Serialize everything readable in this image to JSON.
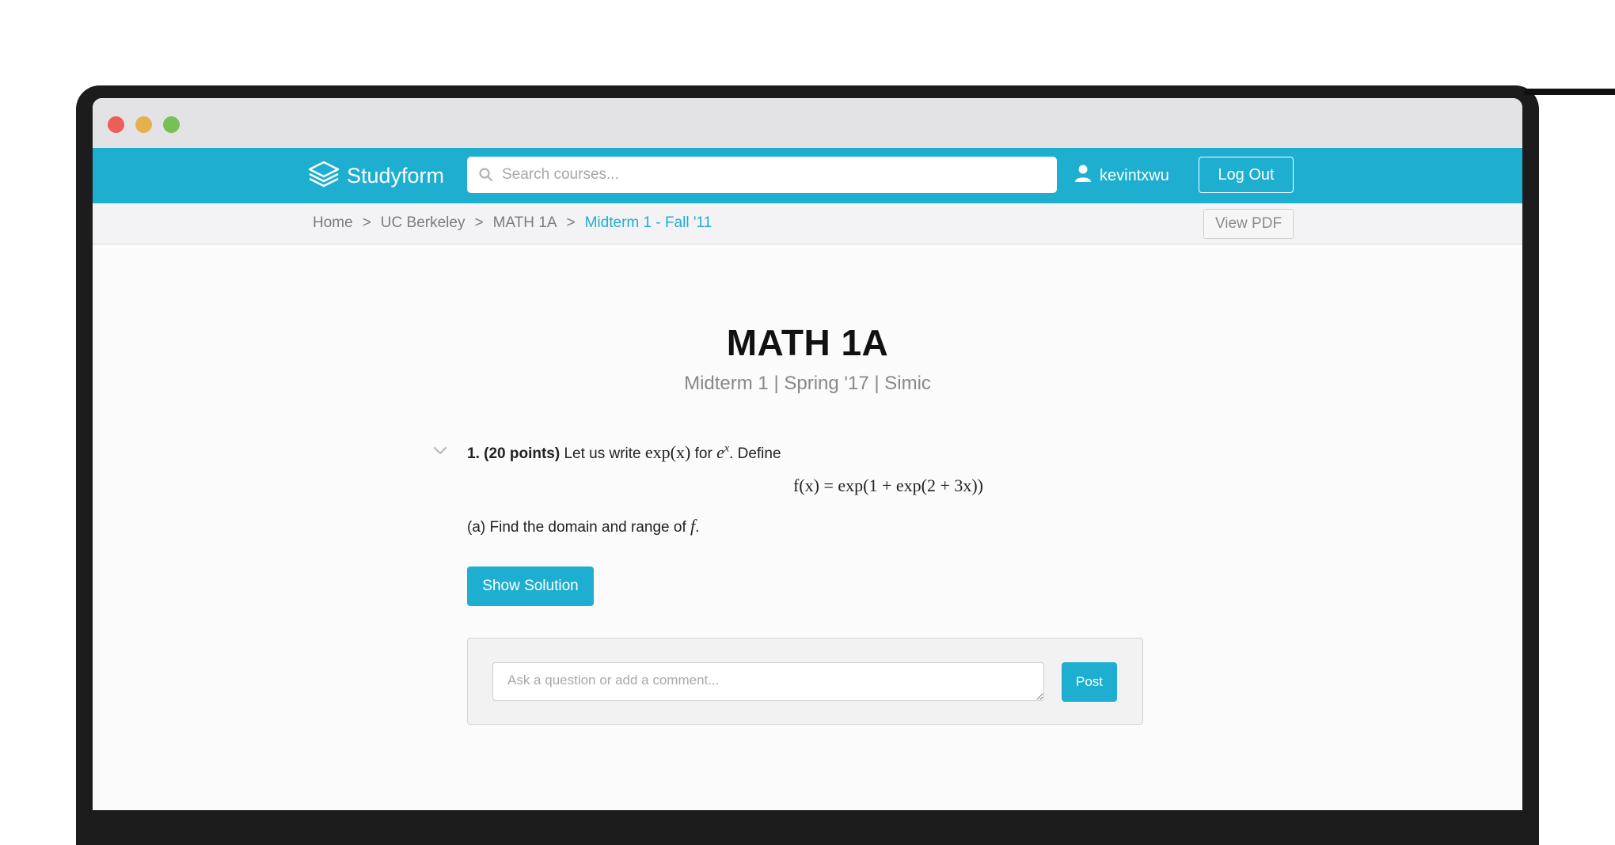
{
  "app": {
    "brand": "Studyform",
    "search_placeholder": "Search courses...",
    "username": "kevintxwu",
    "logout_label": "Log Out",
    "accent_color": "#1eafd0"
  },
  "breadcrumb": {
    "items": [
      "Home",
      "UC Berkeley",
      "MATH 1A"
    ],
    "current": "Midterm 1 - Fall '11",
    "separator": ">"
  },
  "view_pdf_label": "View PDF",
  "exam": {
    "title": "MATH 1A",
    "subtitle": "Midterm 1 | Spring '17 | Simic"
  },
  "question": {
    "number_points": "1. (20 points)",
    "intro_text": "Let us write",
    "math_exp": "exp(x)",
    "for_text": "for",
    "math_ex": "e",
    "math_ex_sup": "x",
    "define_text": ". Define",
    "equation": "f(x) = exp(1 + exp(2 + 3x))",
    "part_a_text": "(a) Find the domain and range of",
    "part_a_math": "f",
    "part_a_end": ".",
    "show_solution_label": "Show Solution"
  },
  "comment": {
    "placeholder": "Ask a question or add a comment...",
    "post_label": "Post"
  }
}
